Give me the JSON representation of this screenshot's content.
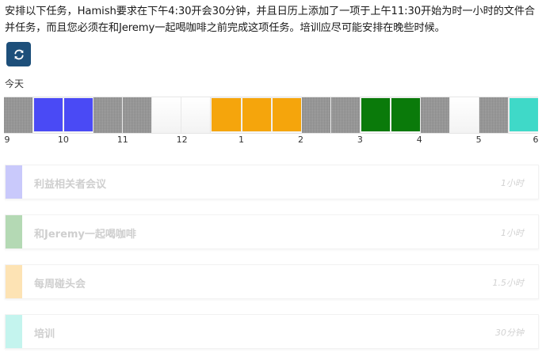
{
  "instructions": "安排以下任务，Hamish要求在下午4:30开会30分钟，并且日历上添加了一项于上午11:30开始为时一小时的文件合并任务，而且您必须在和Jeremy一起喝咖啡之前完成这项任务。培训应尽可能安排在晚些时候。",
  "refresh_icon": "refresh-icon",
  "day_label": "今天",
  "timeline": {
    "slots": [
      {
        "state": "busy",
        "color": "#9a9a9a"
      },
      {
        "state": "task",
        "color": "#4a4af5"
      },
      {
        "state": "task",
        "color": "#4a4af5"
      },
      {
        "state": "busy",
        "color": "#9a9a9a"
      },
      {
        "state": "busy",
        "color": "#9a9a9a"
      },
      {
        "state": "free",
        "color": "#ffffff"
      },
      {
        "state": "free",
        "color": "#ffffff"
      },
      {
        "state": "task",
        "color": "#f5a50c"
      },
      {
        "state": "task",
        "color": "#f5a50c"
      },
      {
        "state": "task",
        "color": "#f5a50c"
      },
      {
        "state": "busy",
        "color": "#9a9a9a"
      },
      {
        "state": "busy",
        "color": "#9a9a9a"
      },
      {
        "state": "task",
        "color": "#0a7a0a"
      },
      {
        "state": "task",
        "color": "#0a7a0a"
      },
      {
        "state": "busy",
        "color": "#9a9a9a"
      },
      {
        "state": "free",
        "color": "#ffffff"
      },
      {
        "state": "busy",
        "color": "#9a9a9a"
      },
      {
        "state": "task",
        "color": "#3fd9c8"
      }
    ],
    "hours": [
      "9",
      "10",
      "11",
      "12",
      "1",
      "2",
      "3",
      "4",
      "5",
      "6"
    ]
  },
  "tasks": [
    {
      "name": "利益相关者会议",
      "duration": "1小时",
      "color": "#c9c9fb"
    },
    {
      "name": "和Jeremy一起喝咖啡",
      "duration": "1小时",
      "color": "#b4d9b4"
    },
    {
      "name": "每周碰头会",
      "duration": "1.5小时",
      "color": "#fde3b4"
    },
    {
      "name": "培训",
      "duration": "30分钟",
      "color": "#c4f4ee"
    }
  ]
}
